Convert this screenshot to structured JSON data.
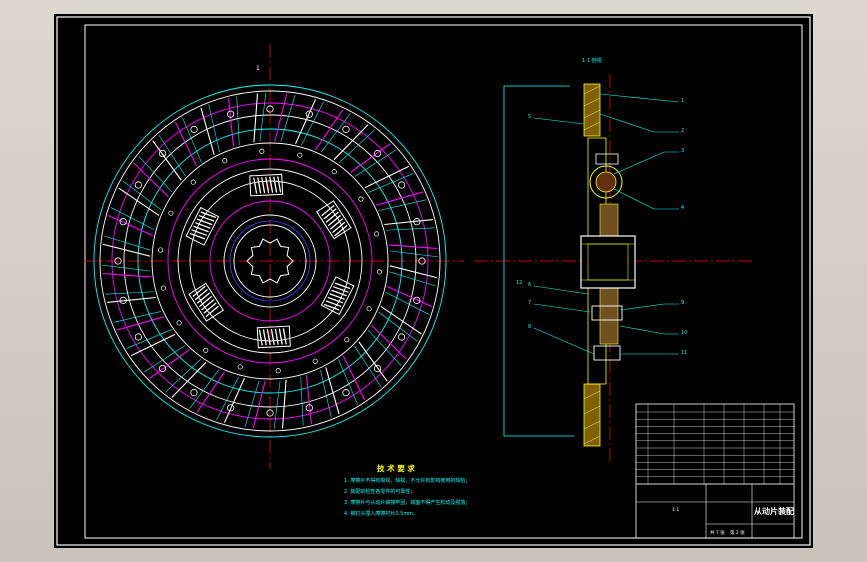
{
  "drawing": {
    "title": "从动片装配",
    "section_label": "1-1 剖视",
    "section_mark": "1",
    "tech_requirements": {
      "heading": "技 术 要 求",
      "items": [
        "1. 摩擦片不得有裂纹、缺损、不允许有影响使用的缺陷；",
        "2. 装配前检查各零件的可靠性；",
        "3. 摩擦片与从动片铆接牢固，端面不得产生松动及脱落；",
        "4. 铆钉头埋入摩擦衬片0.5mm。"
      ]
    },
    "balloons": [
      "1",
      "2",
      "3",
      "4",
      "5",
      "6",
      "7",
      "8",
      "9",
      "10",
      "11",
      "12"
    ],
    "title_block": {
      "sheet": "第 2 张",
      "sheets": "共 7 张",
      "scale": "1:1"
    }
  },
  "colors": {
    "background": "#000000",
    "frame": "#ffffff",
    "center_line": "#ff0000",
    "cyan": "#00ffff",
    "magenta": "#ff00ff",
    "yellow": "#ffff00",
    "blue": "#4040ff"
  }
}
